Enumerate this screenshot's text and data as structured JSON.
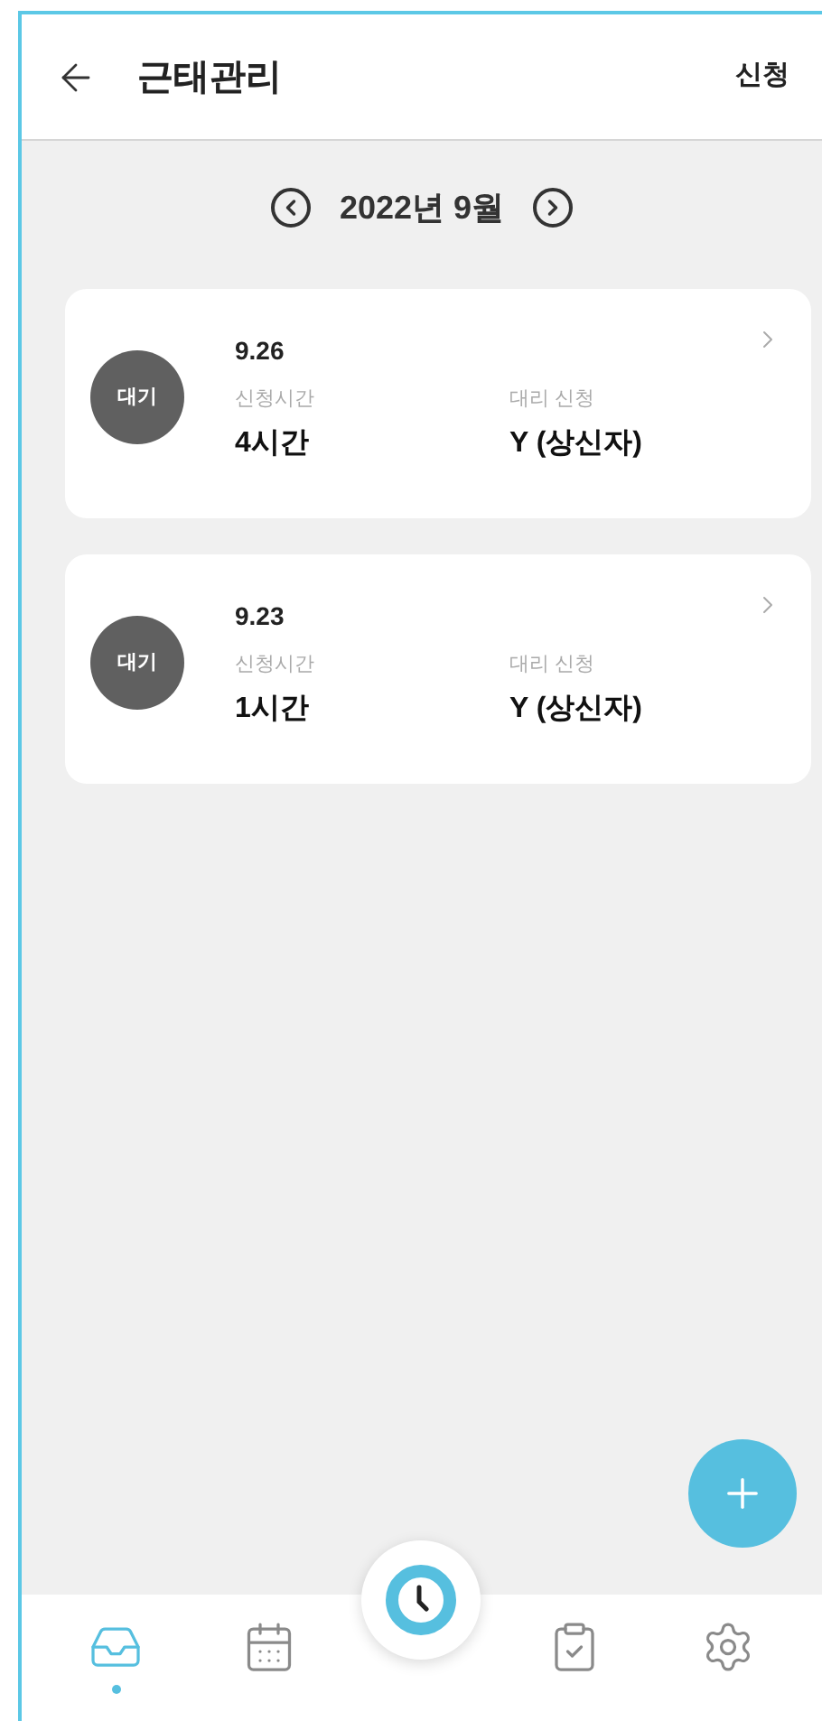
{
  "header": {
    "title": "근태관리",
    "action": "신청"
  },
  "month": {
    "label": "2022년 9월"
  },
  "requests": [
    {
      "status": "대기",
      "date": "9.26",
      "time_label": "신청시간",
      "time": "4시간",
      "proxy_label": "대리 신청",
      "proxy": "Y (상신자)"
    },
    {
      "status": "대기",
      "date": "9.23",
      "time_label": "신청시간",
      "time": "1시간",
      "proxy_label": "대리 신청",
      "proxy": "Y (상신자)"
    }
  ],
  "nav": [
    {
      "kind": "inbox",
      "selected": true
    },
    {
      "kind": "calendar",
      "selected": false
    },
    {
      "kind": "clock",
      "selected": false
    },
    {
      "kind": "clipboard",
      "selected": false
    },
    {
      "kind": "settings",
      "selected": false
    }
  ]
}
